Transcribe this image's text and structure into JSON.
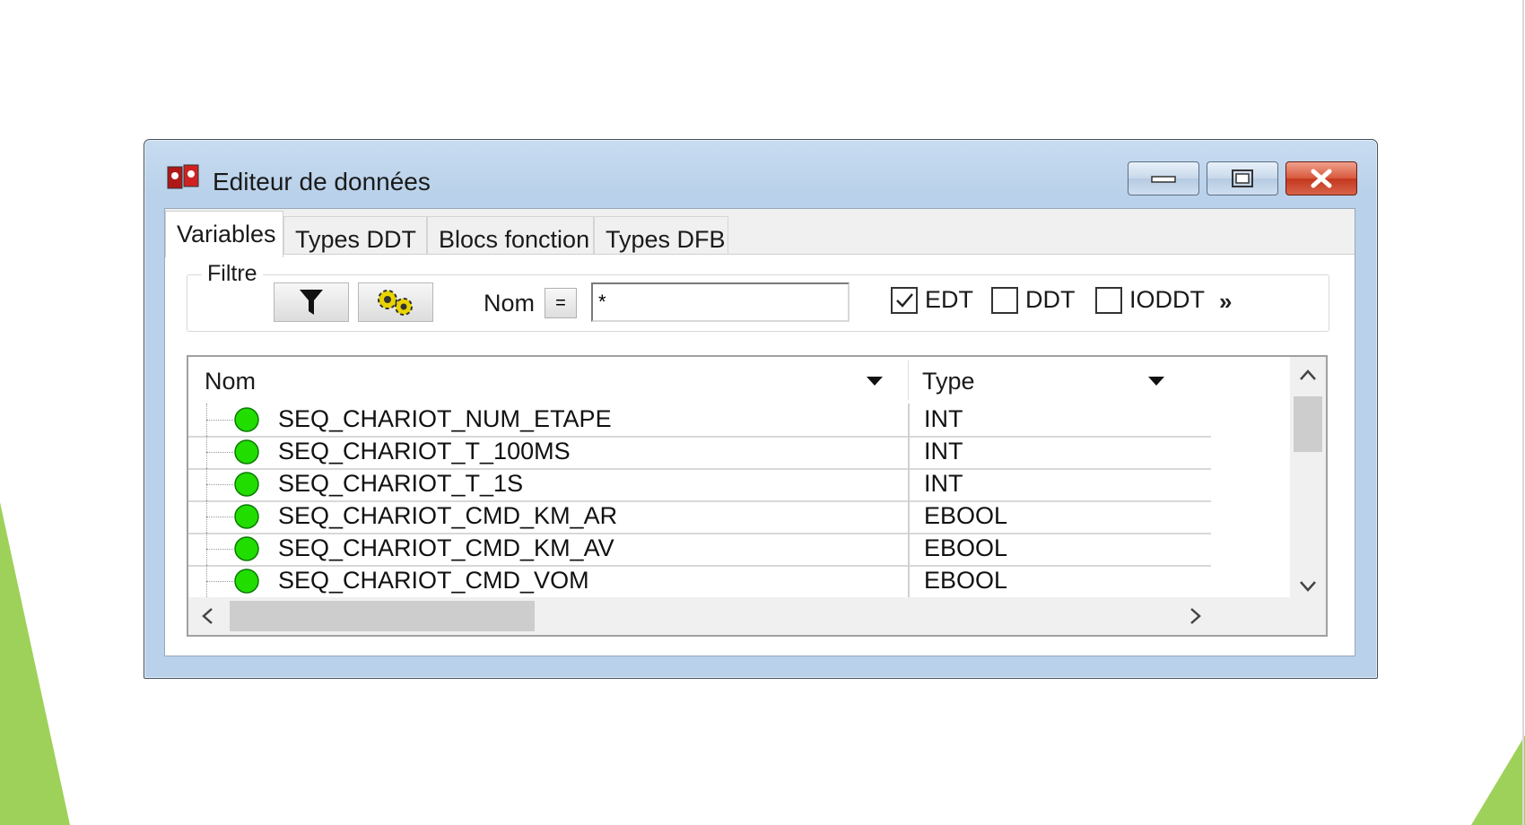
{
  "window": {
    "title": "Editeur de données",
    "accent": "#b9d1ea",
    "close_color": "#c4381e"
  },
  "tabs": [
    {
      "label": "Variables",
      "active": true
    },
    {
      "label": "Types DDT",
      "active": false
    },
    {
      "label": "Blocs fonction",
      "active": false
    },
    {
      "label": "Types DFB",
      "active": false
    }
  ],
  "filter": {
    "legend": "Filtre",
    "filter_icon": "funnel-icon",
    "settings_icon": "gears-icon",
    "nom_label": "Nom",
    "eq_label": "=",
    "nom_value": "*",
    "checkboxes": [
      {
        "label": "EDT",
        "checked": true
      },
      {
        "label": "DDT",
        "checked": false
      },
      {
        "label": "IODDT",
        "checked": false
      }
    ],
    "more_label": "»"
  },
  "grid": {
    "columns": [
      "Nom",
      "Type"
    ],
    "rows": [
      {
        "name": "SEQ_CHARIOT_NUM_ETAPE",
        "type": "INT"
      },
      {
        "name": "SEQ_CHARIOT_T_100MS",
        "type": "INT"
      },
      {
        "name": "SEQ_CHARIOT_T_1S",
        "type": "INT"
      },
      {
        "name": "SEQ_CHARIOT_CMD_KM_AR",
        "type": "EBOOL"
      },
      {
        "name": "SEQ_CHARIOT_CMD_KM_AV",
        "type": "EBOOL"
      },
      {
        "name": "SEQ_CHARIOT_CMD_VOM",
        "type": "EBOOL"
      }
    ],
    "row_icon_color": "#22dd00"
  }
}
